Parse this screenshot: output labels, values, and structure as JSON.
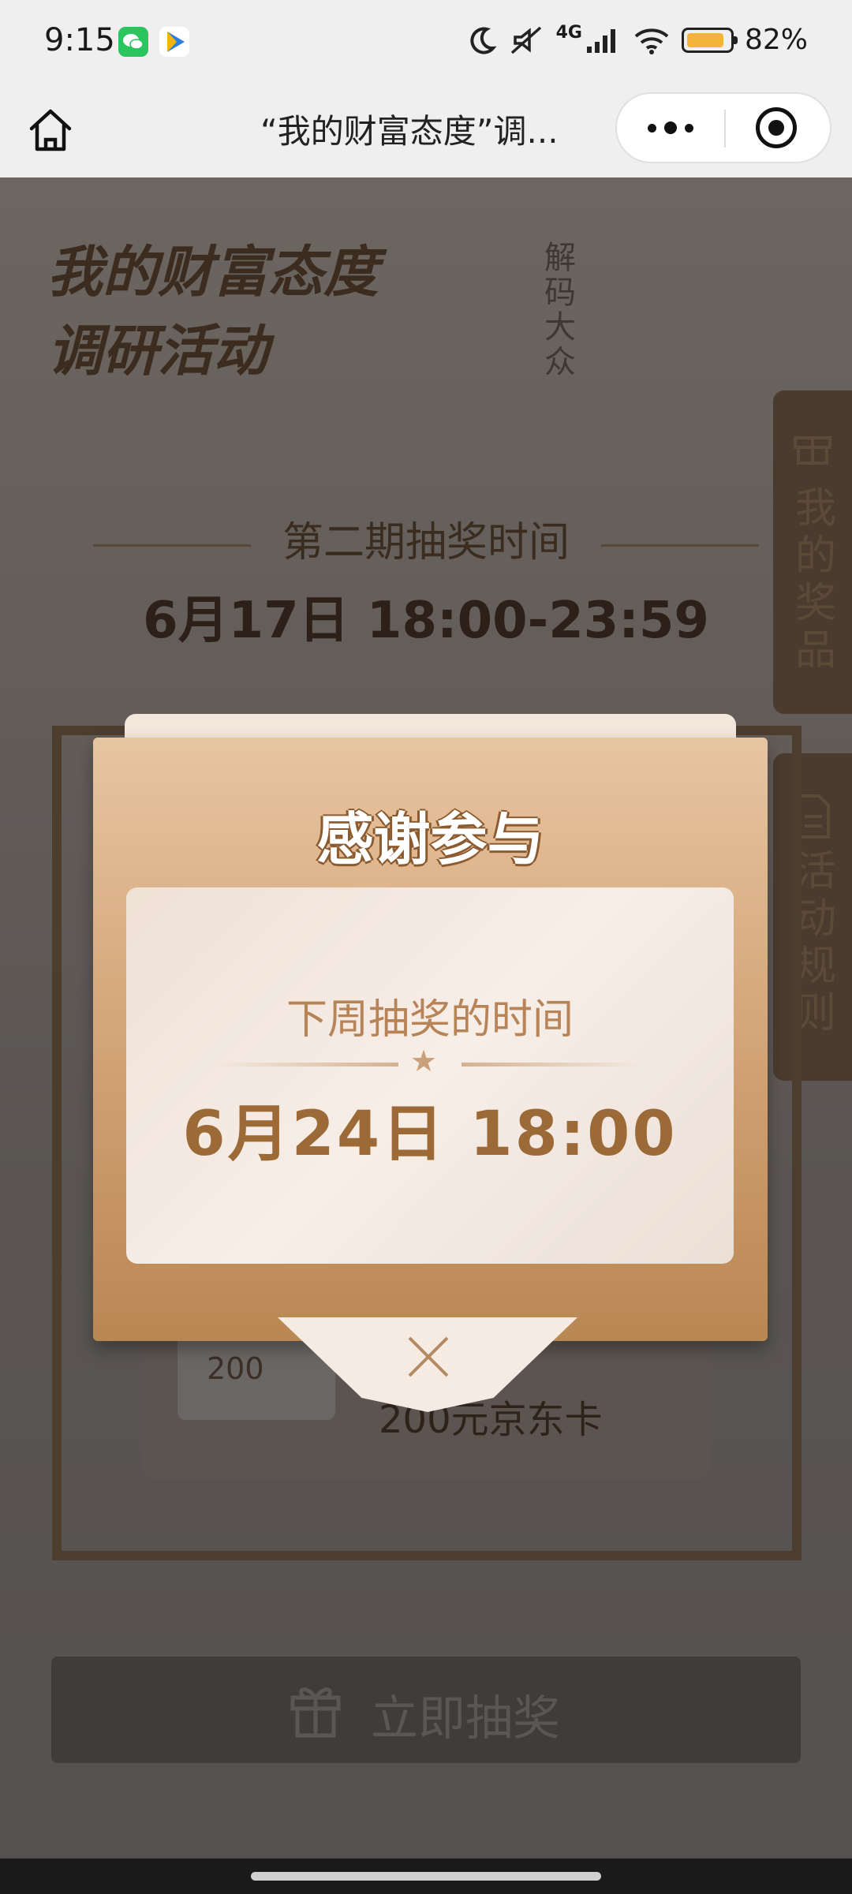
{
  "status_bar": {
    "time": "9:15",
    "network": "4G",
    "battery": "82%",
    "battery_level": 0.82,
    "icons": [
      "wechat-icon",
      "video-app-icon",
      "moon-icon",
      "mute-icon",
      "signal-icon",
      "wifi-icon",
      "battery-icon"
    ]
  },
  "nav": {
    "title": "“我的财富态度”调...",
    "home_icon": "home-icon",
    "more_icon": "more-icon",
    "close_icon": "close-target-icon"
  },
  "background": {
    "hero_title_line1": "我的财富态度",
    "hero_title_line2": "调研活动",
    "hero_sub": "解码大众",
    "round_label": "第二期抽奖时间",
    "round_time": "6月17日 18:00-23:59",
    "side_tab_prizes": "我的奖品",
    "side_tab_rules": "活动规则",
    "prize_card_value": "200",
    "prize_name": "200元京东卡",
    "draw_button": "立即抽奖"
  },
  "modal": {
    "title": "感谢参与",
    "next_label": "下周抽奖的时间",
    "next_time": "6月24日 18:00",
    "divider_star": "★",
    "close_icon": "close-icon"
  },
  "colors": {
    "accent": "#b98752",
    "modal_text": "#9c6a36"
  }
}
